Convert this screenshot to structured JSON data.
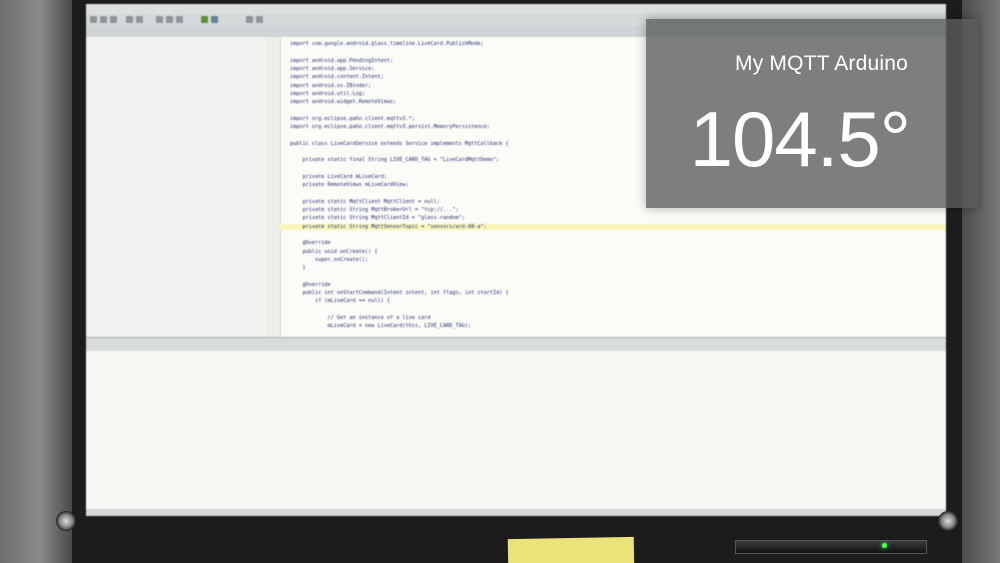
{
  "card": {
    "title": "My MQTT Arduino",
    "value": "104.5°"
  },
  "colors": {
    "card_bg": "#5a5c5e",
    "card_text": "#ffffff",
    "power_led": "#4dff5a",
    "editor_bg": "#fbfbf7",
    "code_text": "#1d2a6e",
    "highlight": "#fbf5b8"
  },
  "ide": {
    "editor": {
      "code_lines": [
        "import com.google.android.glass.timeline.LiveCard.PublishMode;",
        "",
        "import android.app.PendingIntent;",
        "import android.app.Service;",
        "import android.content.Intent;",
        "import android.os.IBinder;",
        "import android.util.Log;",
        "import android.widget.RemoteViews;",
        "",
        "import org.eclipse.paho.client.mqttv3.*;",
        "import org.eclipse.paho.client.mqttv3.persist.MemoryPersistence;",
        "",
        "public class LiveCardService extends Service implements MqttCallback {",
        "",
        "    private static final String LIVE_CARD_TAG = \"LiveCardMqttDemo\";",
        "",
        "    private LiveCard mLiveCard;",
        "    private RemoteViews mLiveCardView;",
        "",
        "    private static MqttClient MqttClient = null;",
        "    private static String MqttBrokerUrl = \"tcp://...\";",
        "    private static String MqttClientId = \"glass-random\";",
        "    private static String MqttSensorTopic = \"sensors/ard-08-a\";",
        "",
        "    @Override",
        "    public void onCreate() {",
        "        super.onCreate();",
        "    }",
        "",
        "    @Override",
        "    public int onStartCommand(Intent intent, int flags, int startId) {",
        "        if (mLiveCard == null) {",
        "",
        "            // Get an instance of a live card",
        "            mLiveCard = new LiveCard(this, LIVE_CARD_TAG);"
      ]
    }
  }
}
